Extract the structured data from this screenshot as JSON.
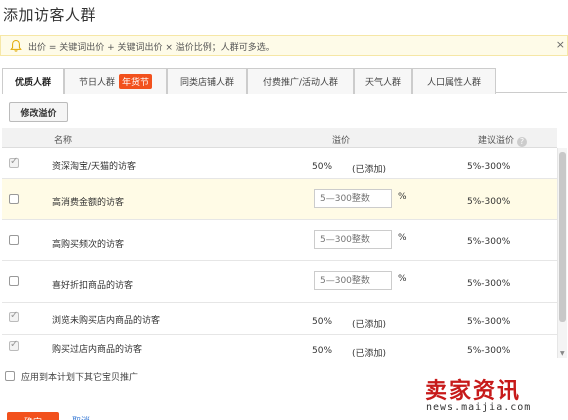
{
  "title": "添加访客人群",
  "notice": {
    "text": "出价 = 关键词出价 + 关键词出价 × 溢价比例；人群可多选。",
    "close": "×"
  },
  "tabs": [
    {
      "label": "优质人群",
      "active": true
    },
    {
      "label": "节日人群",
      "badge": "年货节"
    },
    {
      "label": "同类店铺人群"
    },
    {
      "label": "付费推广/活动人群"
    },
    {
      "label": "天气人群"
    },
    {
      "label": "人口属性人群"
    }
  ],
  "modify_button": "修改溢价",
  "table": {
    "headers": {
      "name": "名称",
      "premium": "溢价",
      "suggested": "建议溢价",
      "help": "?"
    },
    "rows": [
      {
        "name": "资深淘宝/天猫的访客",
        "value": "50%",
        "status": "(已添加)",
        "suggested": "5%-300%",
        "checked": true
      },
      {
        "name": "高消费金额的访客",
        "placeholder": "5—300整数",
        "unit": "%",
        "suggested": "5%-300%",
        "checked": false
      },
      {
        "name": "高购买频次的访客",
        "placeholder": "5—300整数",
        "unit": "%",
        "suggested": "5%-300%",
        "checked": false
      },
      {
        "name": "喜好折扣商品的访客",
        "placeholder": "5—300整数",
        "unit": "%",
        "suggested": "5%-300%",
        "checked": false
      },
      {
        "name": "浏览未购买店内商品的访客",
        "value": "50%",
        "status": "(已添加)",
        "suggested": "5%-300%",
        "checked": true
      },
      {
        "name": "购买过店内商品的访客",
        "value": "50%",
        "status": "(已添加)",
        "suggested": "5%-300%",
        "checked": true
      }
    ]
  },
  "apply_label": "应用到本计划下其它宝贝推广",
  "confirm_button": "确定",
  "cancel_link": "取消",
  "watermark": {
    "main": "卖家资讯",
    "url": "news.maijia.com"
  },
  "colors": {
    "accent": "#f2511d",
    "notice_bg": "#fefbe8",
    "highlight_row": "#fffbe6",
    "link": "#3a7bd5"
  }
}
